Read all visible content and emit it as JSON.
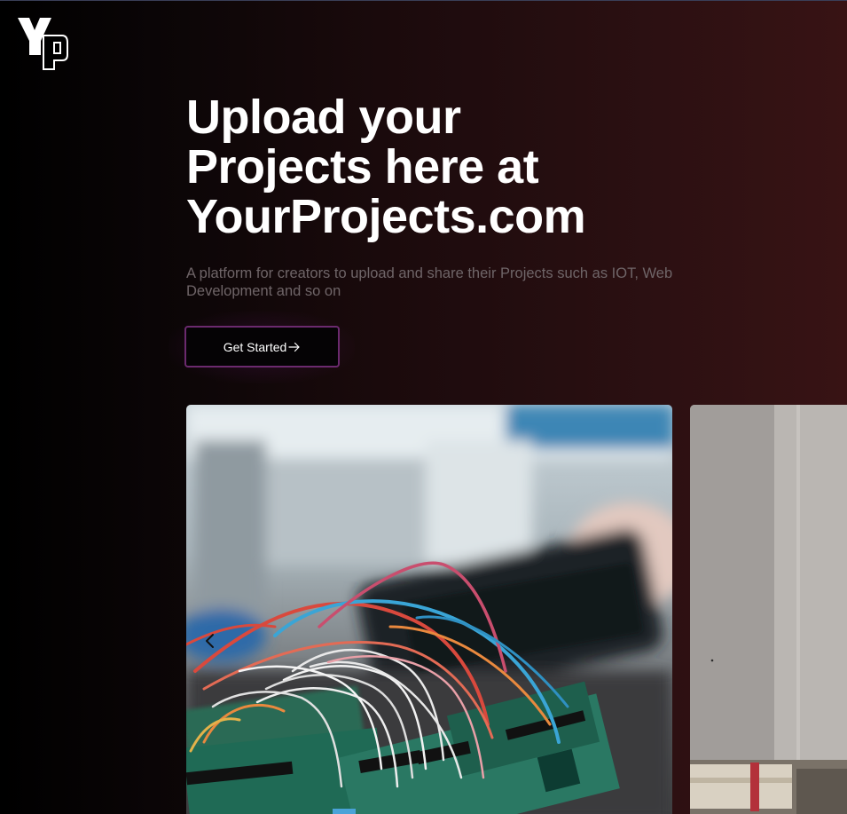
{
  "header": {
    "logo_icon": "yp-logo-icon"
  },
  "hero": {
    "title_lines": [
      "Upload your",
      "Projects here at",
      "YourProjects.com"
    ],
    "subtitle": "A platform for creators to upload and share their Projects such as IOT, Web Development and so on",
    "cta_label": "Get Started",
    "cta_icon": "arrow-right-icon"
  },
  "carousel": {
    "prev_icon": "chevron-left-icon",
    "slides": [
      {
        "image": "electronics-breadboard-photo"
      },
      {
        "image": "desk-notebook-photo"
      }
    ]
  },
  "colors": {
    "background_left": "#000000",
    "background_right": "#381314",
    "cta_border": "#6b2a6e",
    "title": "#ffffff",
    "subtitle": "#6f6568"
  }
}
